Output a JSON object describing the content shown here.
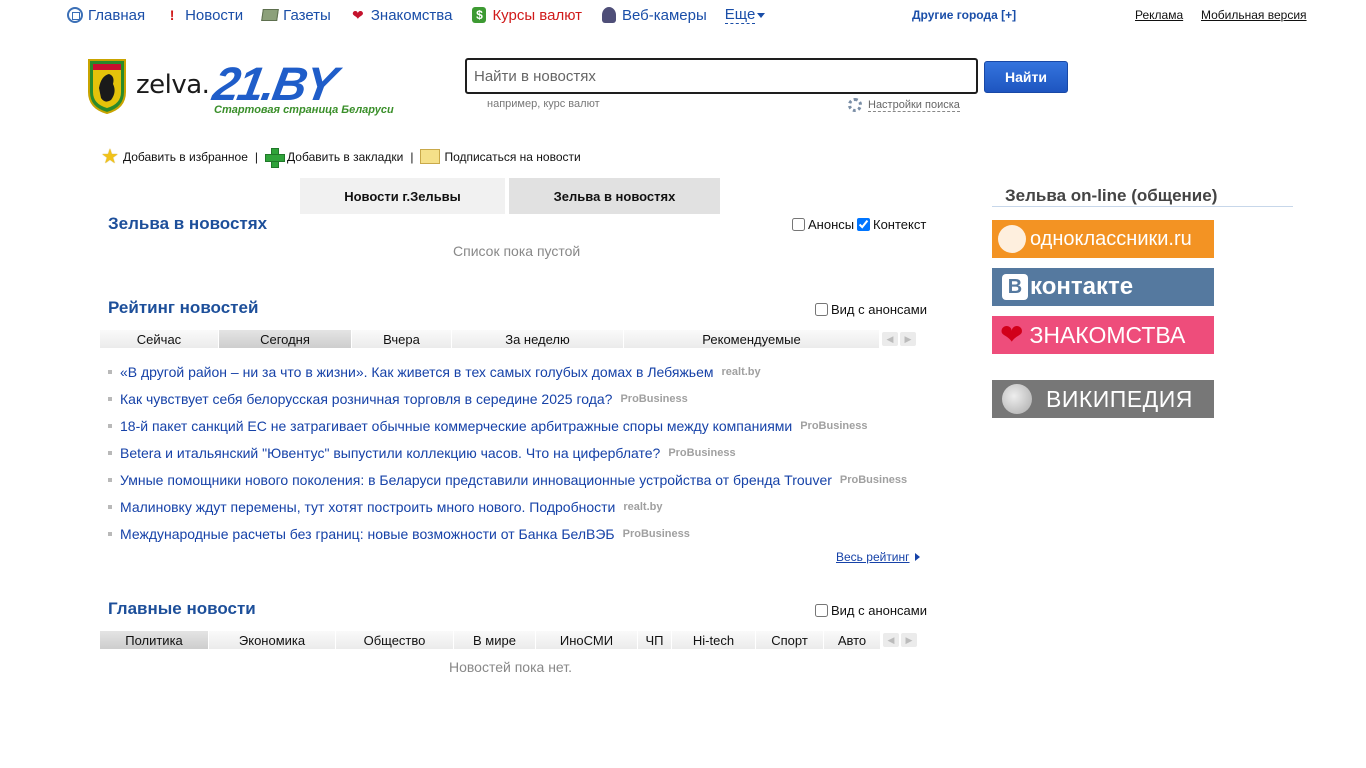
{
  "topnav": {
    "items": [
      {
        "label": "Главная",
        "icon": "home-icon"
      },
      {
        "label": "Новости",
        "icon": "exclamation-icon"
      },
      {
        "label": "Газеты",
        "icon": "newspaper-icon"
      },
      {
        "label": "Знакомства",
        "icon": "heart-icon"
      },
      {
        "label": "Курсы валют",
        "icon": "dollar-icon"
      },
      {
        "label": "Веб-камеры",
        "icon": "webcam-icon"
      }
    ],
    "more": "Еще",
    "other_cities": "Другие города [+]",
    "ads": "Реклама",
    "mobile": "Мобильная версия"
  },
  "logo": {
    "city": "zelva.",
    "site": "21.BY",
    "tagline": "Стартовая страница Беларуси"
  },
  "search": {
    "placeholder": "Найти в новостях",
    "button": "Найти",
    "hint": "например, курс валют",
    "settings": "Настройки поиска"
  },
  "actions": {
    "favorites": "Добавить в избранное",
    "bookmarks": "Добавить в закладки",
    "subscribe": "Подписаться на новости",
    "separator": "|"
  },
  "tabs": [
    "Новости г.Зельвы",
    "Зельва в новостях"
  ],
  "zelva_news": {
    "title": "Зельва в новостях",
    "check_announces": "Анонсы",
    "check_context": "Контекст",
    "empty": "Список пока пустой"
  },
  "rating": {
    "title": "Рейтинг новостей",
    "check_announces": "Вид с анонсами",
    "filters": [
      "Сейчас",
      "Сегодня",
      "Вчера",
      "За неделю",
      "Рекомендуемые"
    ],
    "active_filter": "Сегодня",
    "items": [
      {
        "title": "«В другой район – ни за что в жизни». Как живется в тех самых голубых домах в Лебяжьем",
        "source": "realt.by"
      },
      {
        "title": "Как чувствует себя белорусская розничная торговля в середине 2025 года?",
        "source": "ProBusiness"
      },
      {
        "title": "18-й пакет санкций ЕС не затрагивает обычные коммерческие арбитражные споры между компаниями",
        "source": "ProBusiness"
      },
      {
        "title": "Betera и итальянский \"Ювентус\" выпустили коллекцию часов. Что на циферблате?",
        "source": "ProBusiness"
      },
      {
        "title": "Умные помощники нового поколения: в Беларуси представили инновационные устройства от бренда Trouver",
        "source": "ProBusiness"
      },
      {
        "title": "Малиновку ждут перемены, тут хотят построить много нового. Подробности",
        "source": "realt.by"
      },
      {
        "title": "Международные расчеты без границ: новые возможности от Банка БелВЭБ",
        "source": "ProBusiness"
      }
    ],
    "all_link": "Весь рейтинг"
  },
  "main_news": {
    "title": "Главные новости",
    "check_announces": "Вид с анонсами",
    "filters": [
      "Политика",
      "Экономика",
      "Общество",
      "В мире",
      "ИноСМИ",
      "ЧП",
      "Hi-tech",
      "Спорт",
      "Авто"
    ],
    "active_filter": "Политика",
    "empty": "Новостей пока нет."
  },
  "sidebar": {
    "title": "Зельва on-line (общение)",
    "banners": [
      {
        "label": "одноклассники.ru",
        "color": "#f39323",
        "icon": "odnoklassniki-icon"
      },
      {
        "label": "контакте",
        "color": "#55799f",
        "icon": "vk-icon"
      },
      {
        "label": "ЗНАКОМСТВА",
        "color": "#ee4d7b",
        "icon": "heart-icon"
      },
      {
        "label": "ВИКИПЕДИЯ",
        "color": "#777777",
        "icon": "wikipedia-globe-icon"
      }
    ]
  }
}
